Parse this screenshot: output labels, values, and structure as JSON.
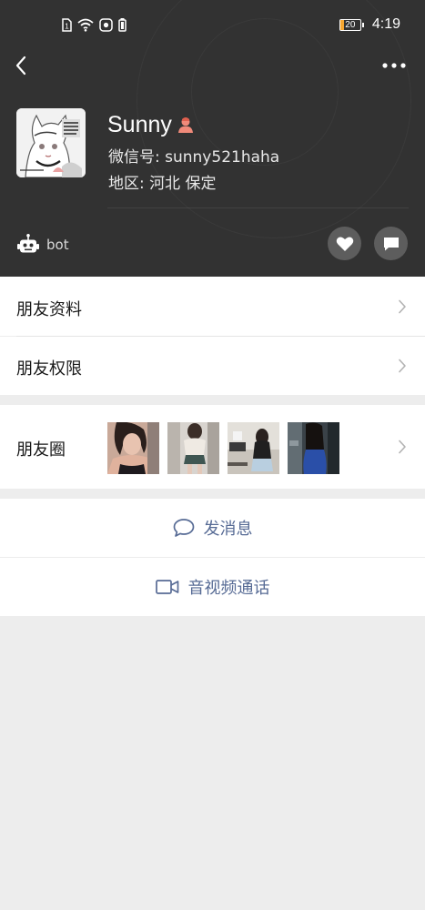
{
  "status_bar": {
    "battery_level": "20",
    "battery_fraction": 0.2,
    "time": "4:19",
    "battery_color": "#f7a731"
  },
  "nav": {
    "back_icon": "chevron-left-icon",
    "more_icon": "more-horizontal-icon"
  },
  "profile": {
    "name": "Sunny",
    "gender_icon": "female-user-icon",
    "wechat_id": "微信号: sunny521haha",
    "region": "地区: 河北  保定"
  },
  "actions_bar": {
    "bot_label": "bot",
    "like_icon": "heart-icon",
    "comment_icon": "message-icon"
  },
  "cells": {
    "friend_profile": "朋友资料",
    "friend_permissions": "朋友权限",
    "moments": "朋友圈"
  },
  "buttons": {
    "send_message": "发消息",
    "video_call": "音视频通话"
  },
  "colors": {
    "header_bg": "#323232",
    "link_blue": "#576b95",
    "page_bg": "#ededed",
    "gender_accent": "#f08a7a"
  }
}
